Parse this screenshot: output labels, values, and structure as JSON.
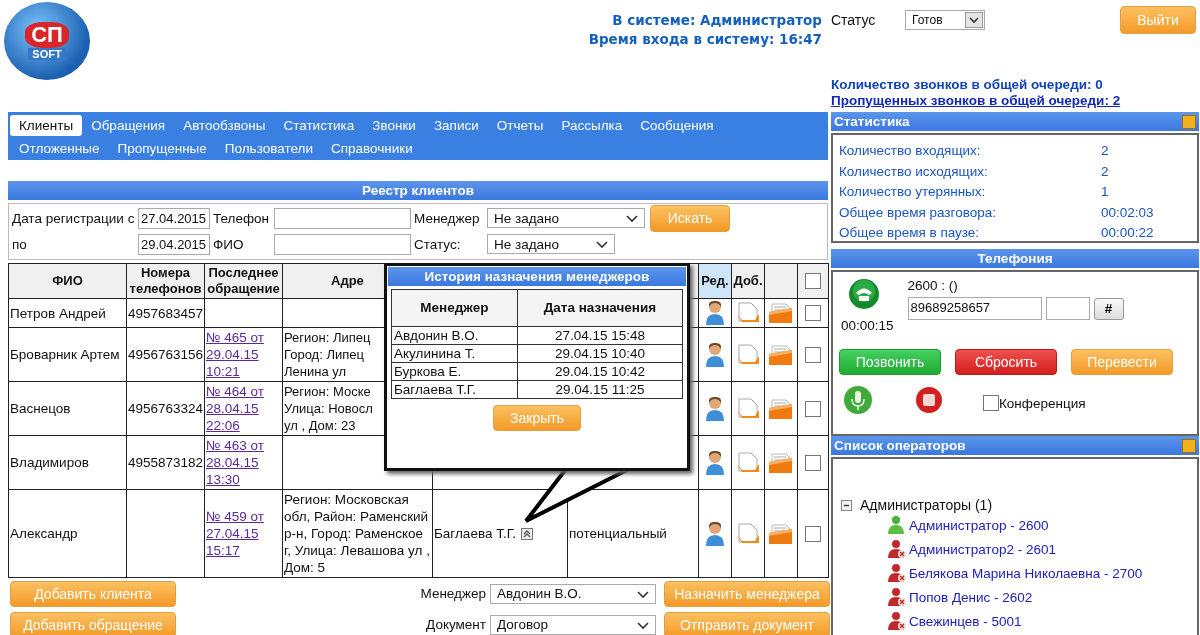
{
  "header": {
    "logo_top": "СП",
    "logo_bottom": "SOFT",
    "online_label": "В системе: Администратор",
    "login_time": "Время входа в систему: 16:47",
    "status_label": "Статус",
    "status_value": "Готов",
    "logout_button": "Выйти"
  },
  "queue": {
    "count": "Количество звонков в общей очереди: 0",
    "missed": "Пропущенных звонков в общей очереди: 2"
  },
  "tabs": [
    [
      {
        "label": "Клиенты",
        "selected": true
      },
      {
        "label": "Обращения",
        "selected": false
      },
      {
        "label": "Автообзвоны",
        "selected": false
      },
      {
        "label": "Статистика",
        "selected": false
      },
      {
        "label": "Звонки",
        "selected": false
      },
      {
        "label": "Записи",
        "selected": false
      },
      {
        "label": "Отчеты",
        "selected": false
      },
      {
        "label": "Рассылка",
        "selected": false
      },
      {
        "label": "Сообщения",
        "selected": false
      }
    ],
    [
      {
        "label": "Отложенные",
        "selected": false
      },
      {
        "label": "Пропущенные",
        "selected": false
      },
      {
        "label": "Пользователи",
        "selected": false
      },
      {
        "label": "Справочники",
        "selected": false
      }
    ]
  ],
  "registry": {
    "title": "Реестр клиентов",
    "filters": {
      "date_from_label": "Дата регистрации с",
      "date_from": "27.04.2015",
      "date_to_label": "по",
      "date_to": "29.04.2015",
      "phone_label": "Телефон",
      "name_label": "ФИО",
      "manager_label": "Менеджер",
      "manager_value": "Не задано",
      "status_label": "Статус:",
      "status_value": "Не задано",
      "search_button": "Искать"
    }
  },
  "table": {
    "columns": [
      {
        "label": "ФИО",
        "highlighted": false
      },
      {
        "label": "Номера телефонов",
        "highlighted": false
      },
      {
        "label": "Последнее обращение",
        "highlighted": false
      },
      {
        "label": "Адре",
        "highlighted": false
      }
    ],
    "edit_column": {
      "label": "Ред.",
      "highlighted": true
    },
    "add_column": {
      "label": "Доб.",
      "highlighted": false
    },
    "header_checked": false,
    "rows": [
      {
        "name": "Петров Андрей",
        "phone": "4957683457",
        "checked": false
      },
      {
        "name": "Броварник Артем",
        "phone": "4956763156",
        "request": "№ 465 от 29.04.15 10:21",
        "address_lines": [
          "Регион: Липец",
          "Город: Липец",
          "Ленина ул"
        ],
        "checked": false
      },
      {
        "name": "Васнецов",
        "phone": "4956763324",
        "request": "№ 464 от 28.04.15 22:06",
        "address_lines": [
          "Регион: Моске",
          "Улица: Новосл",
          "ул , Дом: 23"
        ],
        "checked": false
      },
      {
        "name": "Владимиров",
        "phone": "4955873182",
        "request": "№ 463 от 28.04.15 13:30",
        "checked": false
      },
      {
        "name": "Александр",
        "request": "№ 459 от 27.04.15 15:17",
        "address_lines": [
          "Регион: Московская",
          "обл, Район: Раменский",
          "р-н, Город: Раменское",
          "г, Улица: Левашова ул ,",
          "Дом: 5"
        ],
        "manager": "Баглаева Т.Г.",
        "status": "потенциальный",
        "checked": false
      }
    ]
  },
  "history_popup": {
    "title": "История назначения менеджеров",
    "columns": [
      "Менеджер",
      "Дата назначения"
    ],
    "rows": [
      {
        "manager": "Авдонин В.О.",
        "date": "27.04.15 15:48"
      },
      {
        "manager": "Акулинина Т.",
        "date": "29.04.15 10:40"
      },
      {
        "manager": "Буркова Е.",
        "date": "29.04.15 10:42"
      },
      {
        "manager": "Баглаева Т.Г.",
        "date": "29.04.15 11:25"
      }
    ],
    "close_button": "Закрыть"
  },
  "actions": {
    "add_client": "Добавить клиента",
    "add_request": "Добавить обращение",
    "manager_label": "Менеджер",
    "manager_value": "Авдонин В.О.",
    "assign_button": "Назначить менеджера",
    "document_label": "Документ",
    "document_value": "Договор",
    "send_button": "Отправить документ"
  },
  "statistics": {
    "title": "Статистика",
    "items": [
      {
        "label": "Количество входящих:",
        "value": "2"
      },
      {
        "label": "Количество исходящих:",
        "value": "2"
      },
      {
        "label": "Количество утерянных:",
        "value": "1"
      },
      {
        "label": "Общее время разговора:",
        "value": "00:02:03"
      },
      {
        "label": "Общее время в паузе:",
        "value": "00:00:22"
      }
    ]
  },
  "telephony": {
    "title": "Телефония",
    "line": "2600 : ()",
    "timer": "00:00:15",
    "number": "89689258657",
    "hash_button": "#",
    "call_button": "Позвонить",
    "reset_button": "Сбросить",
    "transfer_button": "Перевести",
    "conference_label": "Конференция",
    "conference_checked": false
  },
  "operators": {
    "title": "Список операторов",
    "groups": [
      {
        "label": "Администраторы (1)",
        "expanded": true,
        "children": [
          {
            "label": "Администратор - 2600",
            "online": true
          },
          {
            "label": "Администратор2 - 2601",
            "online": false
          },
          {
            "label": "Белякова Марина Николаевна - 2700",
            "online": false
          },
          {
            "label": "Попов Денис - 2602",
            "online": false
          },
          {
            "label": "Свежинцев - 5001",
            "online": false
          }
        ]
      }
    ]
  }
}
